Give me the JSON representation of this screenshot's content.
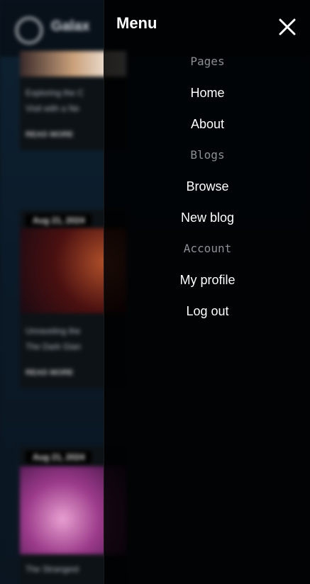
{
  "menu": {
    "title": "Menu",
    "sections": [
      {
        "label": "Pages",
        "items": [
          "Home",
          "About"
        ]
      },
      {
        "label": "Blogs",
        "items": [
          "Browse",
          "New blog"
        ]
      },
      {
        "label": "Account",
        "items": [
          "My profile",
          "Log out"
        ]
      }
    ]
  },
  "background": {
    "logo_text": "Galax",
    "cards": [
      {
        "date": "",
        "lines": [
          "Exploring the C",
          "Visit with a Ne"
        ],
        "read": "READ MORE"
      },
      {
        "date": "Aug 21, 2024",
        "lines": [
          "Unraveling the",
          "The Dark Gian"
        ],
        "read": "READ MORE"
      },
      {
        "date": "Aug 21, 2024",
        "lines": [
          "The Strangest"
        ],
        "read": ""
      }
    ]
  },
  "colors": {
    "menu_bg": "#000000",
    "menu_text": "#ffffff",
    "section_label": "#8c8f93"
  },
  "icons": {
    "close": "close-icon",
    "logo": "logo-icon"
  }
}
